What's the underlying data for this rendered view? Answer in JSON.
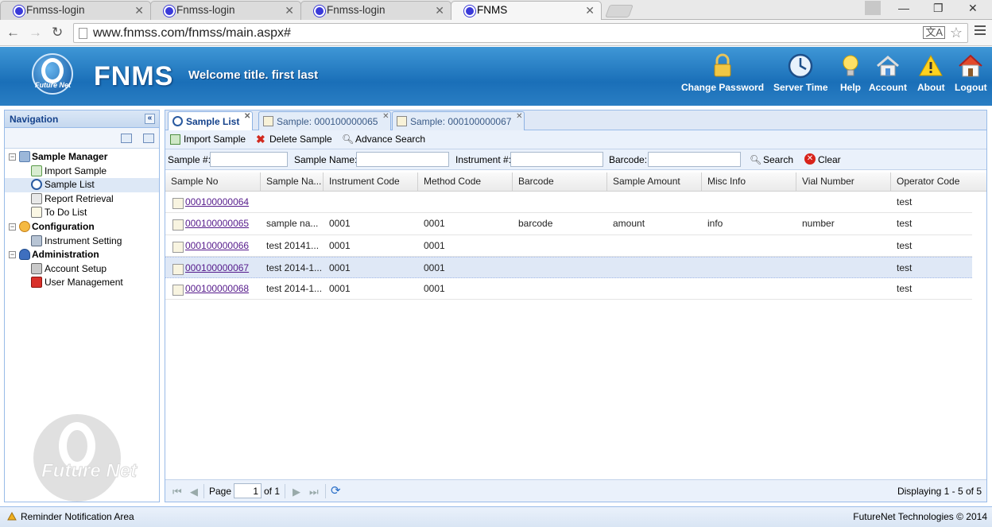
{
  "browser": {
    "tabs": [
      {
        "title": "Fnmss-login"
      },
      {
        "title": "Fnmss-login"
      },
      {
        "title": "Fnmss-login"
      },
      {
        "title": "FNMS"
      }
    ],
    "url": "www.fnmss.com/fnmss/main.aspx#"
  },
  "header": {
    "logo_text": "Future Net",
    "app_name": "FNMS",
    "welcome": "Welcome title. first last",
    "buttons": [
      {
        "label": "Change Password",
        "icon": "lock-icon"
      },
      {
        "label": "Server Time",
        "icon": "clock-icon"
      },
      {
        "label": "Help",
        "icon": "lightbulb-icon"
      },
      {
        "label": "Account",
        "icon": "house-icon"
      },
      {
        "label": "About",
        "icon": "warning-icon"
      },
      {
        "label": "Logout",
        "icon": "home-icon"
      }
    ]
  },
  "navigation": {
    "title": "Navigation",
    "tree": [
      {
        "label": "Sample Manager",
        "root": true
      },
      {
        "label": "Import Sample"
      },
      {
        "label": "Sample List",
        "selected": true
      },
      {
        "label": "Report Retrieval"
      },
      {
        "label": "To Do List"
      },
      {
        "label": "Configuration",
        "root": true
      },
      {
        "label": "Instrument Setting"
      },
      {
        "label": "Administration",
        "root": true
      },
      {
        "label": "Account Setup"
      },
      {
        "label": "User Management"
      }
    ],
    "watermark": "Future Net"
  },
  "main": {
    "tabs": [
      {
        "label": "Sample List"
      },
      {
        "label": "Sample: 000100000065"
      },
      {
        "label": "Sample: 000100000067"
      }
    ],
    "toolbar": {
      "import": "Import Sample",
      "delete": "Delete Sample",
      "advanced": "Advance Search"
    },
    "search": {
      "sample_no_label": "Sample #:",
      "sample_name_label": "Sample Name:",
      "instrument_label": "Instrument #:",
      "barcode_label": "Barcode:",
      "search_button": "Search",
      "clear_button": "Clear"
    },
    "columns": [
      "Sample No",
      "Sample Na...",
      "Instrument Code",
      "Method Code",
      "Barcode",
      "Sample Amount",
      "Misc Info",
      "Vial Number",
      "Operator Code"
    ],
    "rows": [
      {
        "sample_no": "000100000064",
        "sample_name": "",
        "instrument": "",
        "method": "",
        "barcode": "",
        "amount": "",
        "misc": "",
        "vial": "",
        "operator": "test"
      },
      {
        "sample_no": "000100000065",
        "sample_name": "sample na...",
        "instrument": "0001",
        "method": "0001",
        "barcode": "barcode",
        "amount": "amount",
        "misc": "info",
        "vial": "number",
        "operator": "test"
      },
      {
        "sample_no": "000100000066",
        "sample_name": "test 20141...",
        "instrument": "0001",
        "method": "0001",
        "barcode": "",
        "amount": "",
        "misc": "",
        "vial": "",
        "operator": "test"
      },
      {
        "sample_no": "000100000067",
        "sample_name": "test 2014-1...",
        "instrument": "0001",
        "method": "0001",
        "barcode": "",
        "amount": "",
        "misc": "",
        "vial": "",
        "operator": "test",
        "selected": true
      },
      {
        "sample_no": "000100000068",
        "sample_name": "test 2014-1...",
        "instrument": "0001",
        "method": "0001",
        "barcode": "",
        "amount": "",
        "misc": "",
        "vial": "",
        "operator": "test"
      }
    ],
    "pager": {
      "page_label": "Page",
      "page_value": "1",
      "of_label": "of 1",
      "displaying": "Displaying 1 - 5 of 5"
    }
  },
  "footer": {
    "left": "Reminder Notification Area",
    "right": "FutureNet Technologies © 2014"
  },
  "colors": {
    "header_blue": "#1a6fb8",
    "panel_border": "#99bbe8",
    "selected_row": "#dfe8f6",
    "link": "#551a8b"
  }
}
